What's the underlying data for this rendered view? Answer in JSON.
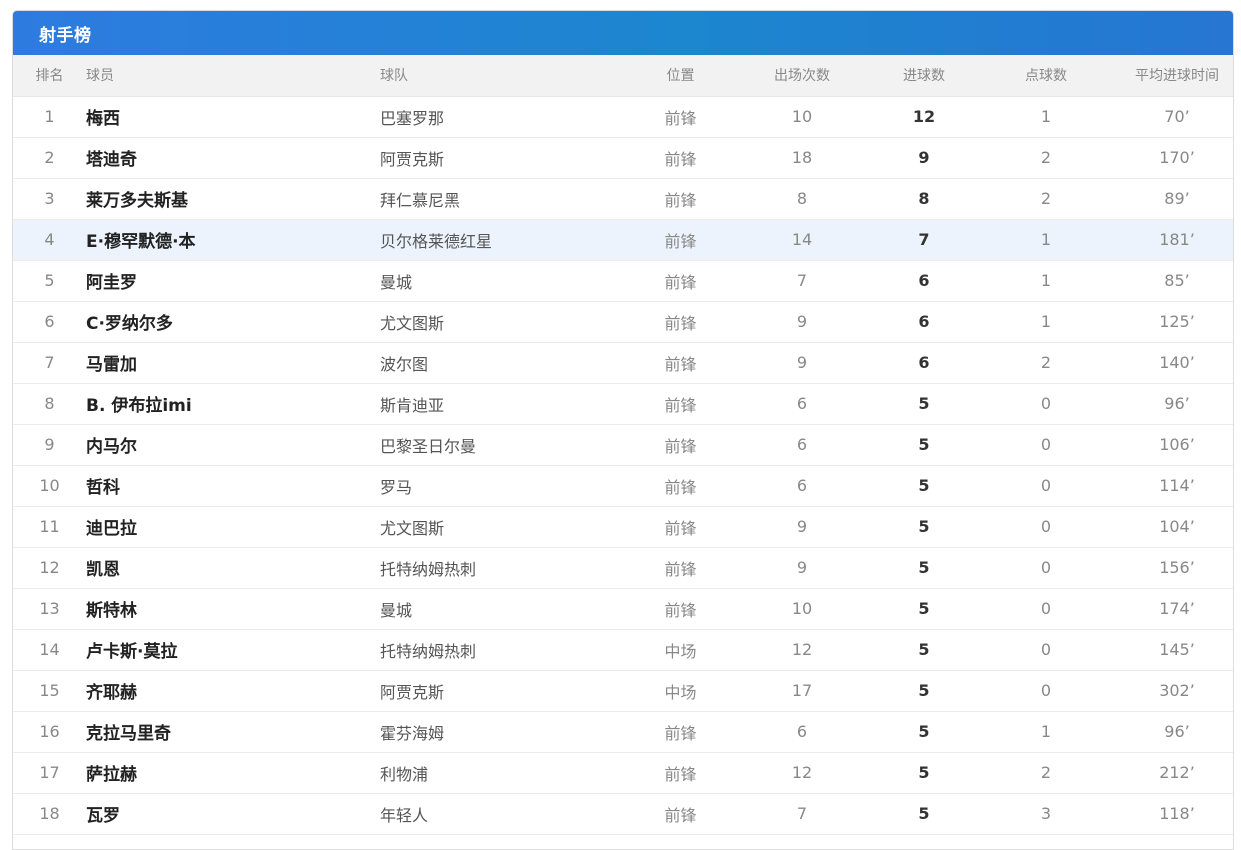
{
  "panel": {
    "title": "射手榜"
  },
  "table": {
    "headers": {
      "rank": "排名",
      "player": "球员",
      "team": "球队",
      "position": "位置",
      "appearances": "出场次数",
      "goals": "进球数",
      "penalties": "点球数",
      "avg_time": "平均进球时间"
    },
    "highlighted_row": 4,
    "rows": [
      {
        "rank": "1",
        "player": "梅西",
        "team": "巴塞罗那",
        "position": "前锋",
        "appearances": "10",
        "goals": "12",
        "penalties": "1",
        "avg_time": "70’"
      },
      {
        "rank": "2",
        "player": "塔迪奇",
        "team": "阿贾克斯",
        "position": "前锋",
        "appearances": "18",
        "goals": "9",
        "penalties": "2",
        "avg_time": "170’"
      },
      {
        "rank": "3",
        "player": "莱万多夫斯基",
        "team": "拜仁慕尼黑",
        "position": "前锋",
        "appearances": "8",
        "goals": "8",
        "penalties": "2",
        "avg_time": "89’"
      },
      {
        "rank": "4",
        "player": "E·穆罕默德·本",
        "team": "贝尔格莱德红星",
        "position": "前锋",
        "appearances": "14",
        "goals": "7",
        "penalties": "1",
        "avg_time": "181’"
      },
      {
        "rank": "5",
        "player": "阿圭罗",
        "team": "曼城",
        "position": "前锋",
        "appearances": "7",
        "goals": "6",
        "penalties": "1",
        "avg_time": "85’"
      },
      {
        "rank": "6",
        "player": "C·罗纳尔多",
        "team": "尤文图斯",
        "position": "前锋",
        "appearances": "9",
        "goals": "6",
        "penalties": "1",
        "avg_time": "125’"
      },
      {
        "rank": "7",
        "player": "马雷加",
        "team": "波尔图",
        "position": "前锋",
        "appearances": "9",
        "goals": "6",
        "penalties": "2",
        "avg_time": "140’"
      },
      {
        "rank": "8",
        "player": "B. 伊布拉imi",
        "team": "斯肯迪亚",
        "position": "前锋",
        "appearances": "6",
        "goals": "5",
        "penalties": "0",
        "avg_time": "96’"
      },
      {
        "rank": "9",
        "player": "内马尔",
        "team": "巴黎圣日尔曼",
        "position": "前锋",
        "appearances": "6",
        "goals": "5",
        "penalties": "0",
        "avg_time": "106’"
      },
      {
        "rank": "10",
        "player": "哲科",
        "team": "罗马",
        "position": "前锋",
        "appearances": "6",
        "goals": "5",
        "penalties": "0",
        "avg_time": "114’"
      },
      {
        "rank": "11",
        "player": "迪巴拉",
        "team": "尤文图斯",
        "position": "前锋",
        "appearances": "9",
        "goals": "5",
        "penalties": "0",
        "avg_time": "104’"
      },
      {
        "rank": "12",
        "player": "凯恩",
        "team": "托特纳姆热刺",
        "position": "前锋",
        "appearances": "9",
        "goals": "5",
        "penalties": "0",
        "avg_time": "156’"
      },
      {
        "rank": "13",
        "player": "斯特林",
        "team": "曼城",
        "position": "前锋",
        "appearances": "10",
        "goals": "5",
        "penalties": "0",
        "avg_time": "174’"
      },
      {
        "rank": "14",
        "player": "卢卡斯·莫拉",
        "team": "托特纳姆热刺",
        "position": "中场",
        "appearances": "12",
        "goals": "5",
        "penalties": "0",
        "avg_time": "145’"
      },
      {
        "rank": "15",
        "player": "齐耶赫",
        "team": "阿贾克斯",
        "position": "中场",
        "appearances": "17",
        "goals": "5",
        "penalties": "0",
        "avg_time": "302’"
      },
      {
        "rank": "16",
        "player": "克拉马里奇",
        "team": "霍芬海姆",
        "position": "前锋",
        "appearances": "6",
        "goals": "5",
        "penalties": "1",
        "avg_time": "96’"
      },
      {
        "rank": "17",
        "player": "萨拉赫",
        "team": "利物浦",
        "position": "前锋",
        "appearances": "12",
        "goals": "5",
        "penalties": "2",
        "avg_time": "212’"
      },
      {
        "rank": "18",
        "player": "瓦罗",
        "team": "年轻人",
        "position": "前锋",
        "appearances": "7",
        "goals": "5",
        "penalties": "3",
        "avg_time": "118’"
      }
    ]
  }
}
